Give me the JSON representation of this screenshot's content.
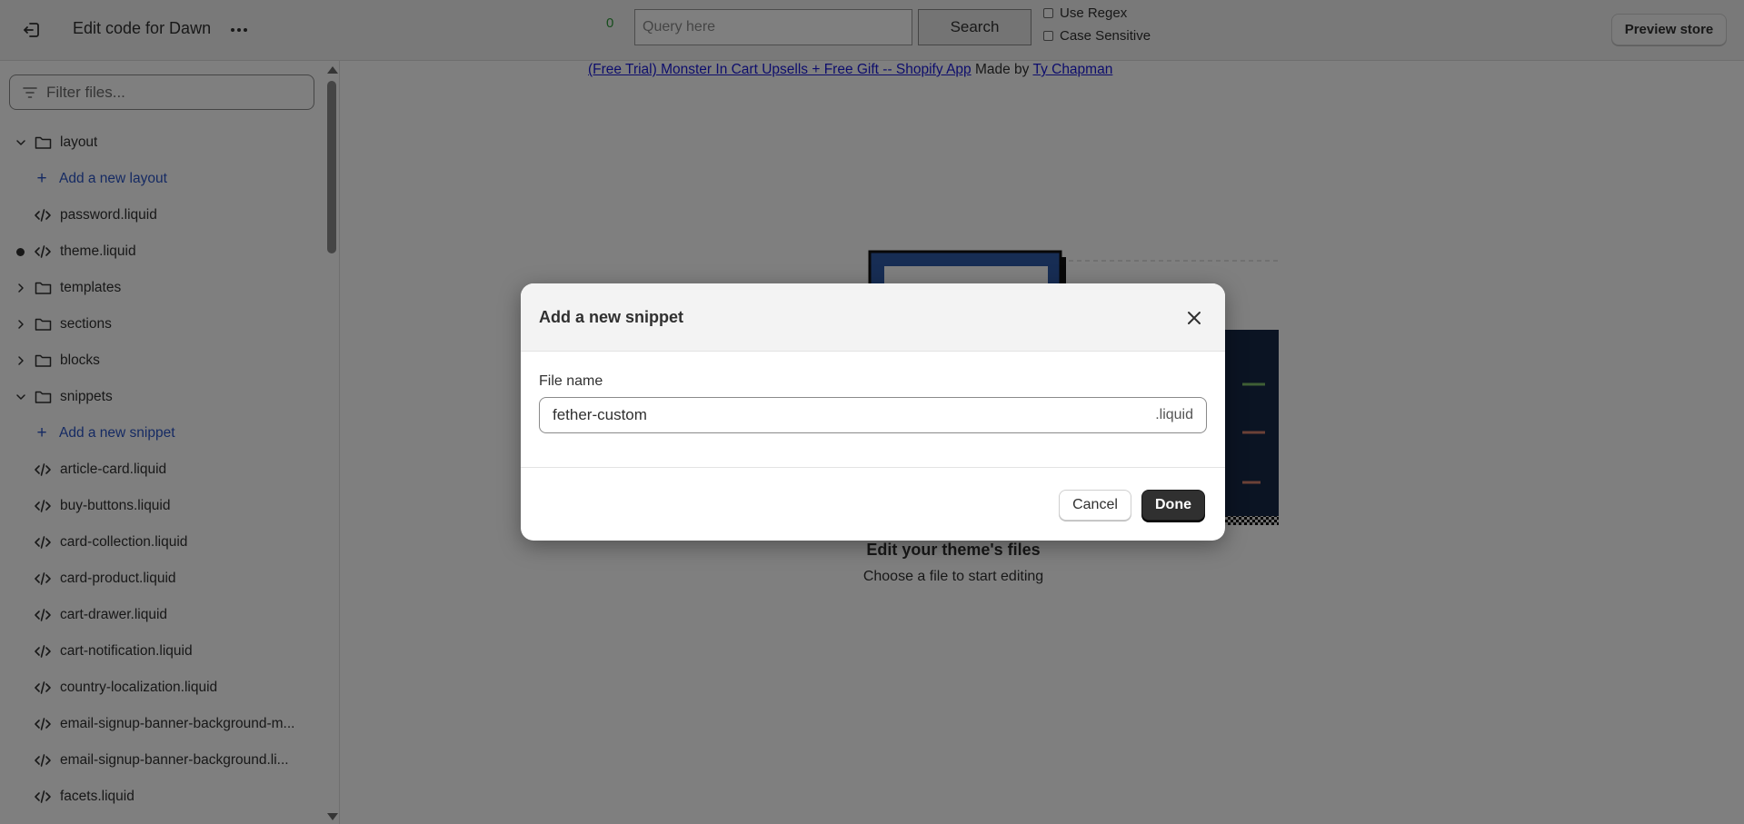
{
  "topbar": {
    "title": "Edit code for Dawn",
    "match_count": "0",
    "query_placeholder": "Query here",
    "search_label": "Search",
    "use_regex_label": "Use Regex",
    "case_sensitive_label": "Case Sensitive",
    "preview_label": "Preview store"
  },
  "sidebar": {
    "filter_placeholder": "Filter files...",
    "items": [
      {
        "label": "layout"
      },
      {
        "label": "Add a new layout"
      },
      {
        "label": "password.liquid"
      },
      {
        "label": "theme.liquid"
      },
      {
        "label": "templates"
      },
      {
        "label": "sections"
      },
      {
        "label": "blocks"
      },
      {
        "label": "snippets"
      },
      {
        "label": "Add a new snippet"
      },
      {
        "label": "article-card.liquid"
      },
      {
        "label": "buy-buttons.liquid"
      },
      {
        "label": "card-collection.liquid"
      },
      {
        "label": "card-product.liquid"
      },
      {
        "label": "cart-drawer.liquid"
      },
      {
        "label": "cart-notification.liquid"
      },
      {
        "label": "country-localization.liquid"
      },
      {
        "label": "email-signup-banner-background-m..."
      },
      {
        "label": "email-signup-banner-background.li..."
      },
      {
        "label": "facets.liquid"
      }
    ]
  },
  "main": {
    "promo_link": "(Free Trial) Monster In Cart Upsells + Free Gift -- Shopify App",
    "promo_made_by": "Made by",
    "promo_author": "Ty Chapman",
    "empty_title": "Edit your theme's files",
    "empty_subtitle": "Choose a file to start editing"
  },
  "modal": {
    "title": "Add a new snippet",
    "field_label": "File name",
    "field_value": "fether-custom",
    "field_suffix": ".liquid",
    "cancel_label": "Cancel",
    "done_label": "Done"
  },
  "colors": {
    "accent_link": "#2b55c6",
    "match_count": "#2e9a3a",
    "primary_button": "#303030",
    "overlay": "rgba(0,0,0,0.5)"
  }
}
